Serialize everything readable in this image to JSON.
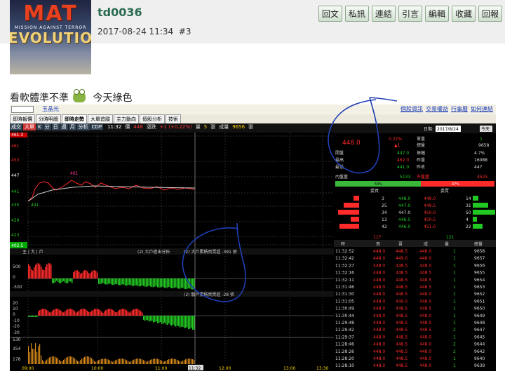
{
  "post": {
    "username": "td0036",
    "timestamp": "2017-08-24 11:34",
    "floor": "#3",
    "buttons": [
      "回文",
      "私訊",
      "連結",
      "引言",
      "編輯",
      "收藏",
      "回報"
    ],
    "content_before": "看軟體準不準",
    "content_after": "今天綠色",
    "avatar": {
      "logo": "MAT",
      "tagline": "MISSION AGAINST TERROR",
      "evo": "EVOLUTIO"
    }
  },
  "app": {
    "stock_name": "玉晶光",
    "top_links": [
      "個股資訊",
      "交易權益",
      "行事曆",
      "如何連結"
    ],
    "tabs": [
      "即時報價",
      "分時明細",
      "即時走勢",
      "大單追蹤",
      "主力動向",
      "個股分析",
      "技術"
    ],
    "selected_tab": 2,
    "toolbar_modes": [
      "成交",
      "大單",
      "K",
      "分",
      "日",
      "週",
      "月",
      "分析",
      "CDP"
    ],
    "toolbar": {
      "time": "11:32",
      "price_label": "價",
      "price": "448",
      "chg_label": "漲跌",
      "chg": "+1 (+0.22%)",
      "vol_label": "量",
      "vol": "5",
      "vol_unit": "張",
      "total_label": "成量",
      "total": "9656",
      "total_unit": "張"
    },
    "date_label": "日期:",
    "date": "2017/8/24",
    "date_btn": "今天",
    "y_price": [
      "461.3",
      "461",
      "453",
      "447",
      "441",
      "435",
      "429",
      "423",
      "402.5"
    ],
    "open_label": "441",
    "peak_label": "461",
    "mid_labels": {
      "left": "大戶進出分析",
      "mid": "大戶累積買賣超 -391 張",
      "mid2": "散戶累積買賣超 -28 張",
      "btn": "(2)"
    },
    "y_osc1": [
      "500",
      "0",
      "-500"
    ],
    "y_osc2": [
      "20",
      "10",
      "0",
      "-10",
      "-20",
      "-30"
    ],
    "y_vol": [
      "530",
      "354",
      "178"
    ],
    "x_labels": [
      "09:00",
      "10:00",
      "11:00",
      "11:32",
      "12:00",
      "13:00",
      "13:30"
    ],
    "quote": {
      "price": "448.0",
      "pct": "0.22%",
      "chg": "▲1",
      "sheet_label": "單量",
      "sheet": "1",
      "total_label": "總量",
      "total": "9658",
      "rows": [
        [
          "開盤",
          "447.0",
          "振幅",
          "4.7%"
        ],
        [
          "最高",
          "462.0",
          "昨量",
          "16088"
        ],
        [
          "最低",
          "441.0",
          "昨收",
          "447"
        ]
      ],
      "inner_label": "內盤量",
      "inner": "5133",
      "outer_label": "外盤量",
      "outer": "4525",
      "inner_pct": "53%",
      "outer_pct": "47%"
    },
    "book_headers": [
      "委買",
      "委賣"
    ],
    "book": [
      [
        "3",
        "448.0",
        "449.0",
        "14"
      ],
      [
        "25",
        "447.0",
        "449.5",
        "31"
      ],
      [
        "34",
        "447.0",
        "450.0",
        "50"
      ],
      [
        "13",
        "446.5",
        "450.5",
        "4"
      ],
      [
        "42",
        "446.0",
        "451.0",
        "22"
      ]
    ],
    "book_total": [
      "117",
      "121"
    ],
    "tick_headers": [
      "時",
      "買",
      "賣",
      "成",
      "量",
      "總量"
    ],
    "ticks": [
      [
        "11:32:52",
        "448.0",
        "448.5",
        "448.0",
        "1",
        "9658"
      ],
      [
        "11:32:42",
        "448.0",
        "449.0",
        "448.0",
        "1",
        "9657"
      ],
      [
        "11:32:27",
        "448.0",
        "448.5",
        "448.0",
        "1",
        "9656"
      ],
      [
        "11:32:16",
        "448.0",
        "448.5",
        "448.5",
        "1",
        "9655"
      ],
      [
        "11:32:11",
        "448.0",
        "448.5",
        "448.5",
        "1",
        "9654"
      ],
      [
        "11:31:46",
        "448.0",
        "448.5",
        "448.5",
        "1",
        "9653"
      ],
      [
        "11:31:30",
        "448.0",
        "448.5",
        "448.0",
        "1",
        "9652"
      ],
      [
        "11:31:05",
        "448.0",
        "449.0",
        "448.0",
        "1",
        "9651"
      ],
      [
        "11:30:49",
        "448.0",
        "448.5",
        "448.5",
        "1",
        "9650"
      ],
      [
        "11:30:44",
        "448.0",
        "448.5",
        "448.0",
        "1",
        "9649"
      ],
      [
        "11:29:48",
        "448.0",
        "448.5",
        "448.0",
        "1",
        "9648"
      ],
      [
        "11:29:42",
        "448.0",
        "448.5",
        "448.5",
        "2",
        "9647"
      ],
      [
        "11:29:37",
        "448.0",
        "448.5",
        "448.0",
        "1",
        "9645"
      ],
      [
        "11:28:46",
        "448.0",
        "448.5",
        "448.0",
        "2",
        "9644"
      ],
      [
        "11:28:26",
        "448.0",
        "448.5",
        "448.0",
        "2",
        "9642"
      ],
      [
        "11:28:20",
        "448.0",
        "448.5",
        "448.0",
        "1",
        "9640"
      ],
      [
        "11:28:10",
        "448.0",
        "448.5",
        "448.0",
        "1",
        "9639"
      ]
    ]
  },
  "colors": {
    "up": "#ff2a2a",
    "down": "#22c822",
    "text": "#cfcfcf",
    "accent": "#2a6b52",
    "ink": "#1f3fb5"
  }
}
